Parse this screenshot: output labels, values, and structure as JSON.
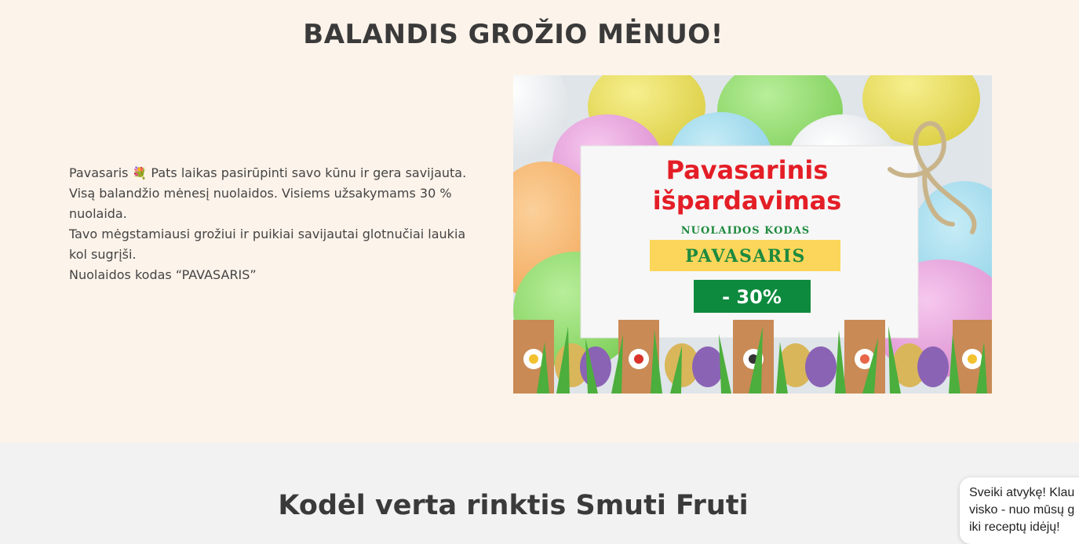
{
  "promo": {
    "title": "BALANDIS GROŽIO MĖNUO!",
    "line1_a": "Pavasaris",
    "flower_icon": "flower-bouquet-icon",
    "line1_b": "Pats laikas pasirūpinti savo kūnu ir gera savijauta.",
    "line2": "Visą balandžio mėnesį nuolaidos. Visiems užsakymams 30 % nuolaida.",
    "line3": "Tavo mėgstamiausi grožiui ir puikiai savijautai glotnučiai laukia kol sugrįši.",
    "line4": "Nuolaidos kodas “PAVASARIS”"
  },
  "banner": {
    "title_line1": "Pavasarinis",
    "title_line2": "išpardavimas",
    "code_label": "NUOLAIDOS KODAS",
    "code": "PAVASARIS",
    "discount": "- 30%",
    "colors": {
      "title": "#e41e26",
      "code_label": "#1e8a3e",
      "code_bg": "#fcd65a",
      "discount_bg": "#0d8a3d"
    }
  },
  "why": {
    "title": "Kodėl verta rinktis Smuti Fruti"
  },
  "chat": {
    "line1": "Sveiki atvykę! Klau",
    "line2": "visko - nuo mūsų g",
    "line3": "iki receptų idėjų!"
  }
}
